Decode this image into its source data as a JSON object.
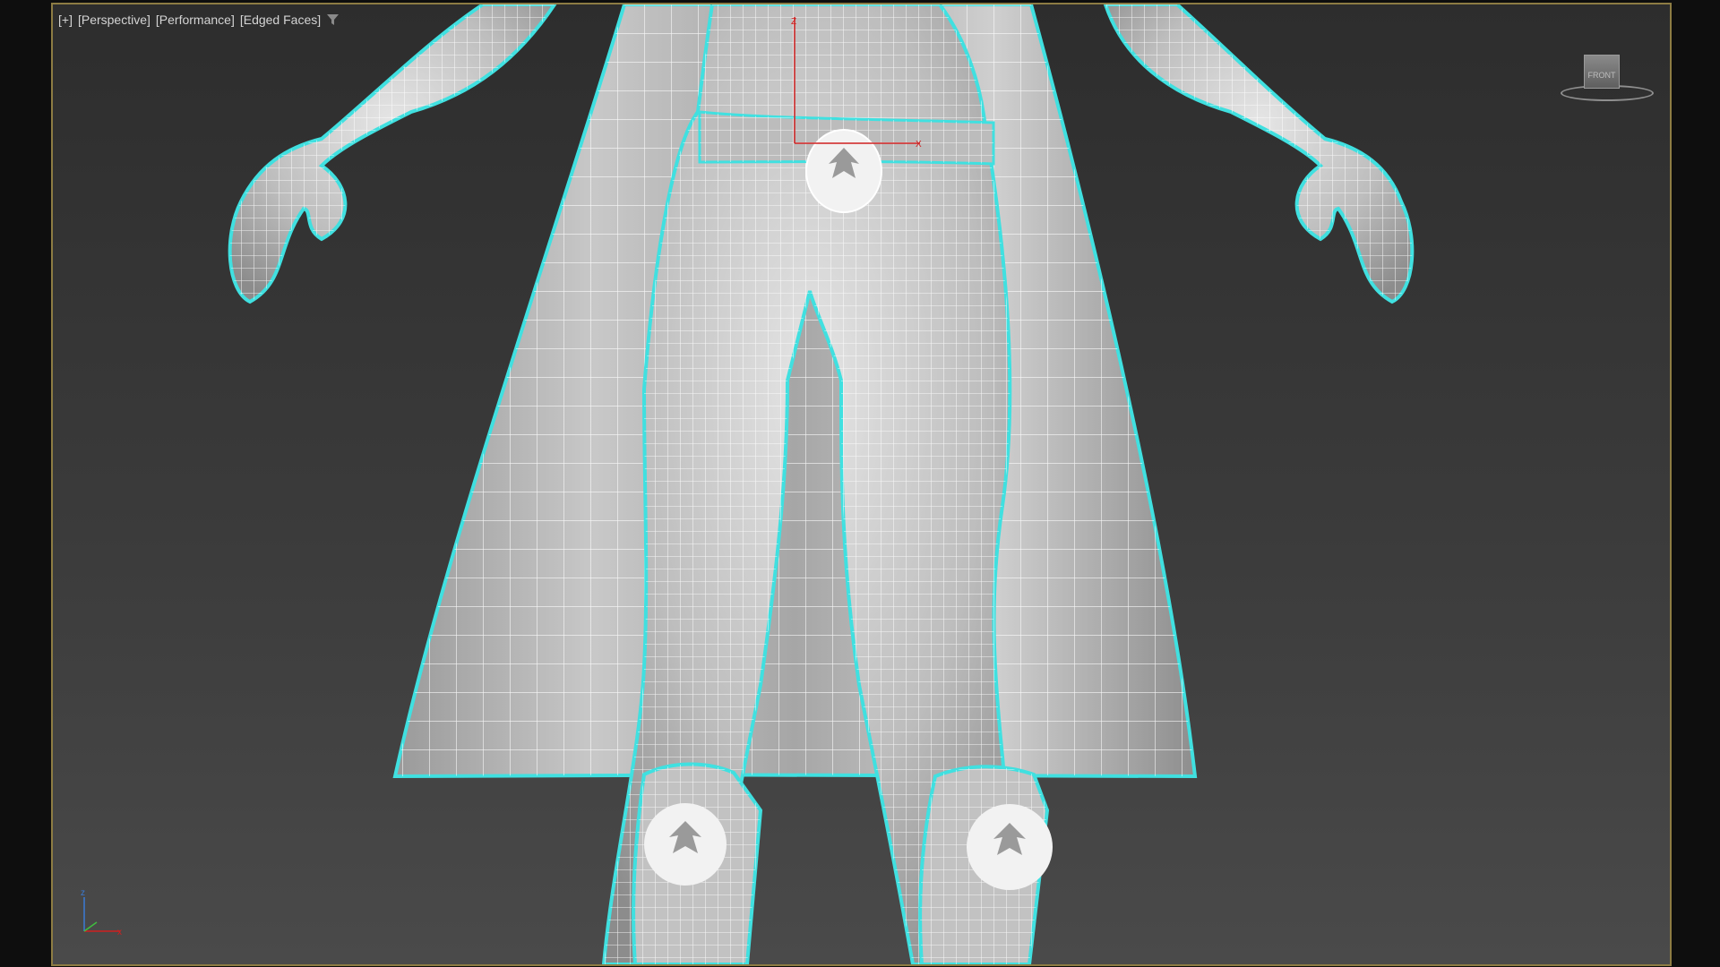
{
  "viewport": {
    "label_plus": "[+]",
    "label_view": "[Perspective]",
    "label_shading": "[Performance]",
    "label_mode": "[Edged Faces]",
    "filter_icon": "funnel-icon",
    "border_color": "#8d7c43",
    "selection_color": "#40e0e0",
    "wire_color": "#ffffff"
  },
  "viewcube": {
    "face_label": "FRONT"
  },
  "gizmo": {
    "x_label": "X",
    "z_label": "Z",
    "color": "#d02020"
  },
  "axis_tripod": {
    "x_label": "x",
    "z_label": "z"
  }
}
